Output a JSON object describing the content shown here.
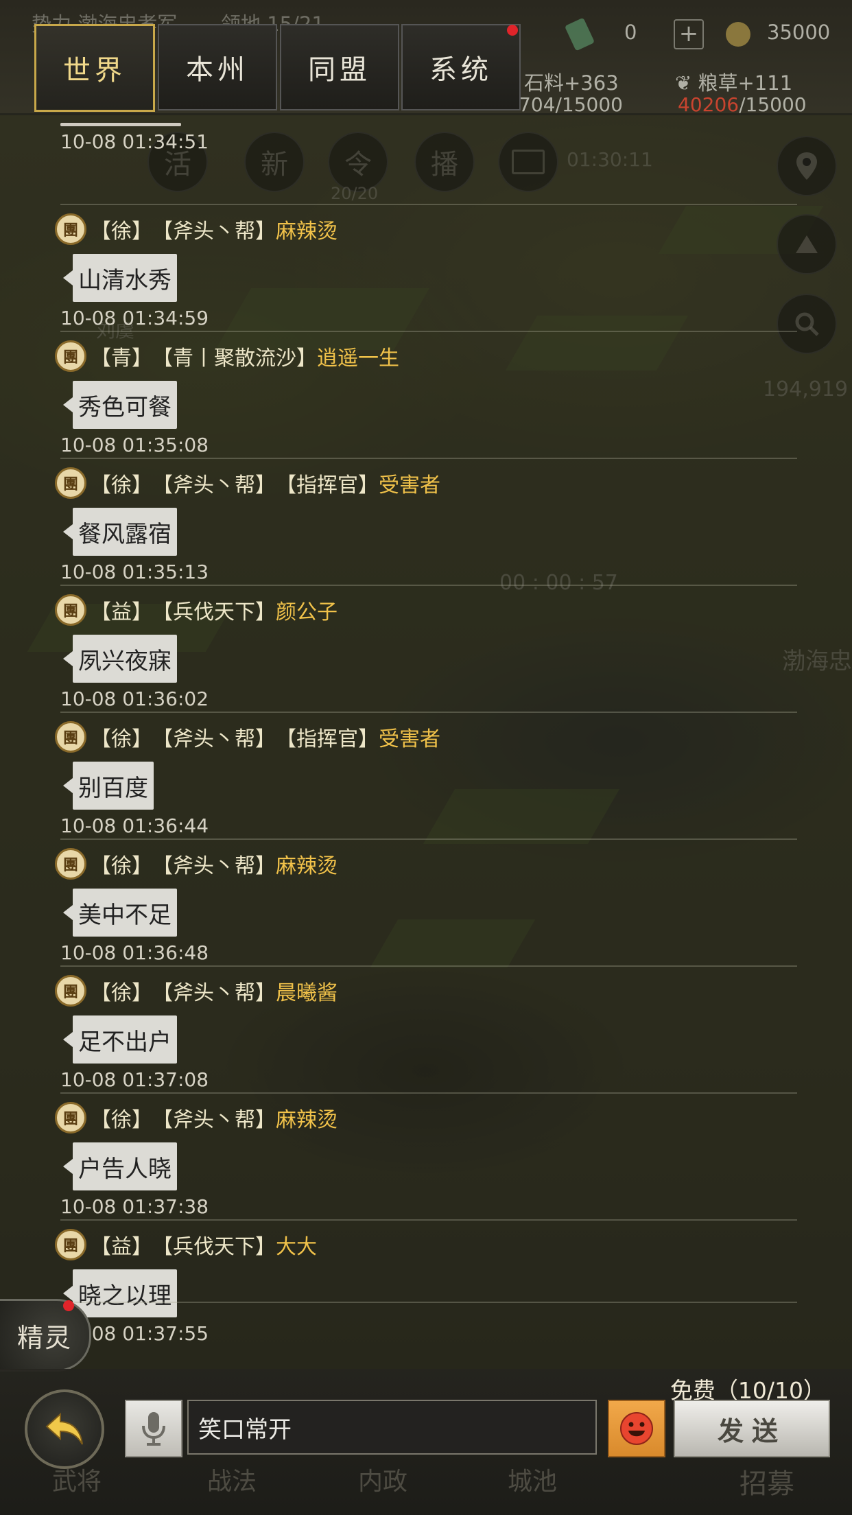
{
  "header": {
    "tabs": [
      {
        "label": "世界",
        "active": true
      },
      {
        "label": "本州",
        "active": false
      },
      {
        "label": "同盟",
        "active": false
      },
      {
        "label": "系统",
        "active": false,
        "notification": true
      }
    ],
    "resources": {
      "faction_partial": "势力 渤海忠孝军",
      "territory_partial": "领地 15/21",
      "gold_value": "0",
      "copper_value": "35000",
      "stone_rate": "石料+363",
      "stone_amount": "704/15000",
      "grain_rate": "粮草+111",
      "grain_current": "40206",
      "grain_max": "/15000"
    }
  },
  "map_hud": {
    "buttons": [
      "活",
      "新",
      "令",
      "播"
    ],
    "troops": "20/20",
    "timer": "01:30:11",
    "count": "194,919",
    "march_timer": "00 : 00 : 57",
    "city_label": "渤海忠",
    "player_label": "刘虞"
  },
  "chat": {
    "top_timestamp": "10-08 01:34:51",
    "messages": [
      {
        "badge": "團",
        "state": "【徐】",
        "alliance": "【斧头丶帮】",
        "role": "",
        "name": "麻辣烫",
        "text": "山清水秀",
        "time": "10-08 01:34:59"
      },
      {
        "badge": "團",
        "state": "【青】",
        "alliance": "【青丨聚散流沙】",
        "role": "",
        "name": "逍遥一生",
        "text": "秀色可餐",
        "time": "10-08 01:35:08"
      },
      {
        "badge": "團",
        "state": "【徐】",
        "alliance": "【斧头丶帮】",
        "role": "【指挥官】",
        "name": "受害者",
        "text": "餐风露宿",
        "time": "10-08 01:35:13"
      },
      {
        "badge": "團",
        "state": "【益】",
        "alliance": "【兵伐天下】",
        "role": "",
        "name": "颜公子",
        "text": "夙兴夜寐",
        "time": "10-08 01:36:02"
      },
      {
        "badge": "團",
        "state": "【徐】",
        "alliance": "【斧头丶帮】",
        "role": "【指挥官】",
        "name": "受害者",
        "text": "别百度",
        "time": "10-08 01:36:44"
      },
      {
        "badge": "團",
        "state": "【徐】",
        "alliance": "【斧头丶帮】",
        "role": "",
        "name": "麻辣烫",
        "text": "美中不足",
        "time": "10-08 01:36:48"
      },
      {
        "badge": "團",
        "state": "【徐】",
        "alliance": "【斧头丶帮】",
        "role": "",
        "name": "晨曦酱",
        "text": "足不出户",
        "time": "10-08 01:37:08"
      },
      {
        "badge": "團",
        "state": "【徐】",
        "alliance": "【斧头丶帮】",
        "role": "",
        "name": "麻辣烫",
        "text": "户告人晓",
        "time": "10-08 01:37:38"
      },
      {
        "badge": "團",
        "state": "【益】",
        "alliance": "【兵伐天下】",
        "role": "",
        "name": "大大",
        "text": "晓之以理",
        "time": "10-08 01:37:55"
      }
    ]
  },
  "spirit": {
    "label": "精灵",
    "notification": true
  },
  "input_bar": {
    "free_label": "免费（10/10）",
    "input_value": "笑口常开",
    "send_label": "发送"
  },
  "bottom_nav": [
    "武将",
    "战法",
    "内政",
    "城池",
    "招募"
  ],
  "colors": {
    "name": "#f1c24a",
    "tab_active": "#c8a84a",
    "badge_bg": "#e8d7a8",
    "notification": "#e0242a"
  }
}
